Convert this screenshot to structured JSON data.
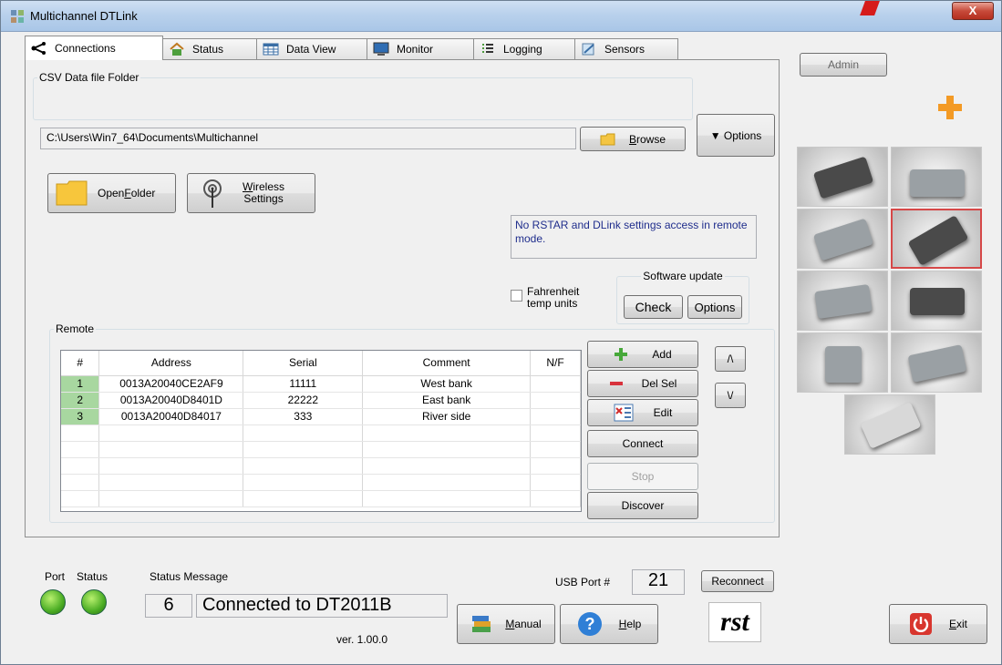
{
  "window": {
    "title": "Multichannel DTLink",
    "close_label": "X"
  },
  "tabs": [
    {
      "label": "Connections",
      "icon": "share-icon"
    },
    {
      "label": "Status",
      "icon": "home-icon"
    },
    {
      "label": "Data View",
      "icon": "table-icon"
    },
    {
      "label": "Monitor",
      "icon": "monitor-icon"
    },
    {
      "label": "Logging",
      "icon": "list-icon"
    },
    {
      "label": "Sensors",
      "icon": "sensors-icon"
    }
  ],
  "csv": {
    "legend": "CSV Data file Folder",
    "path": "C:\\Users\\Win7_64\\Documents\\Multichannel",
    "browse_label": "rowse",
    "browse_mnemonic": "B"
  },
  "options_button": "▼ Options",
  "open_folder": {
    "label_pre": "Open ",
    "mnemonic": "F",
    "label_post": "older"
  },
  "wireless": {
    "mnemonic": "W",
    "line1_rest": "ireless",
    "line2": "Settings"
  },
  "info_message": "No RSTAR and DLink settings access in remote mode.",
  "fahrenheit": {
    "line1": "Fahrenheit",
    "line2": "temp units"
  },
  "software_update": {
    "legend": "Software update",
    "check": "Check",
    "options": "Options"
  },
  "remote": {
    "legend": "Remote",
    "columns": [
      "#",
      "Address",
      "Serial",
      "Comment",
      "N/F"
    ],
    "rows": [
      {
        "num": "1",
        "address": "0013A20040CE2AF9",
        "serial": "11111",
        "comment": "West bank",
        "nf": ""
      },
      {
        "num": "2",
        "address": "0013A20040D8401D",
        "serial": "22222",
        "comment": "East bank",
        "nf": ""
      },
      {
        "num": "3",
        "address": "0013A20040D84017",
        "serial": "333",
        "comment": "River side",
        "nf": ""
      }
    ],
    "buttons": {
      "add": "Add",
      "del": "Del Sel",
      "edit": "Edit",
      "connect": "Connect",
      "stop": "Stop",
      "discover": "Discover",
      "up": "/\\",
      "down": "\\/"
    }
  },
  "admin": "Admin",
  "status": {
    "port_label": "Port",
    "status_label": "Status",
    "message_label": "Status Message",
    "code": "6",
    "message": "Connected to DT2011B",
    "version": "ver.  1.00.0",
    "usb_label": "USB Port #",
    "usb_port": "21",
    "reconnect": "Reconnect"
  },
  "bottom_buttons": {
    "manual_mnemonic": "M",
    "manual_rest": "anual",
    "help_mnemonic": "H",
    "help_rest": "elp",
    "exit_mnemonic": "E",
    "exit_rest": "xit"
  },
  "logo_text": "rst"
}
